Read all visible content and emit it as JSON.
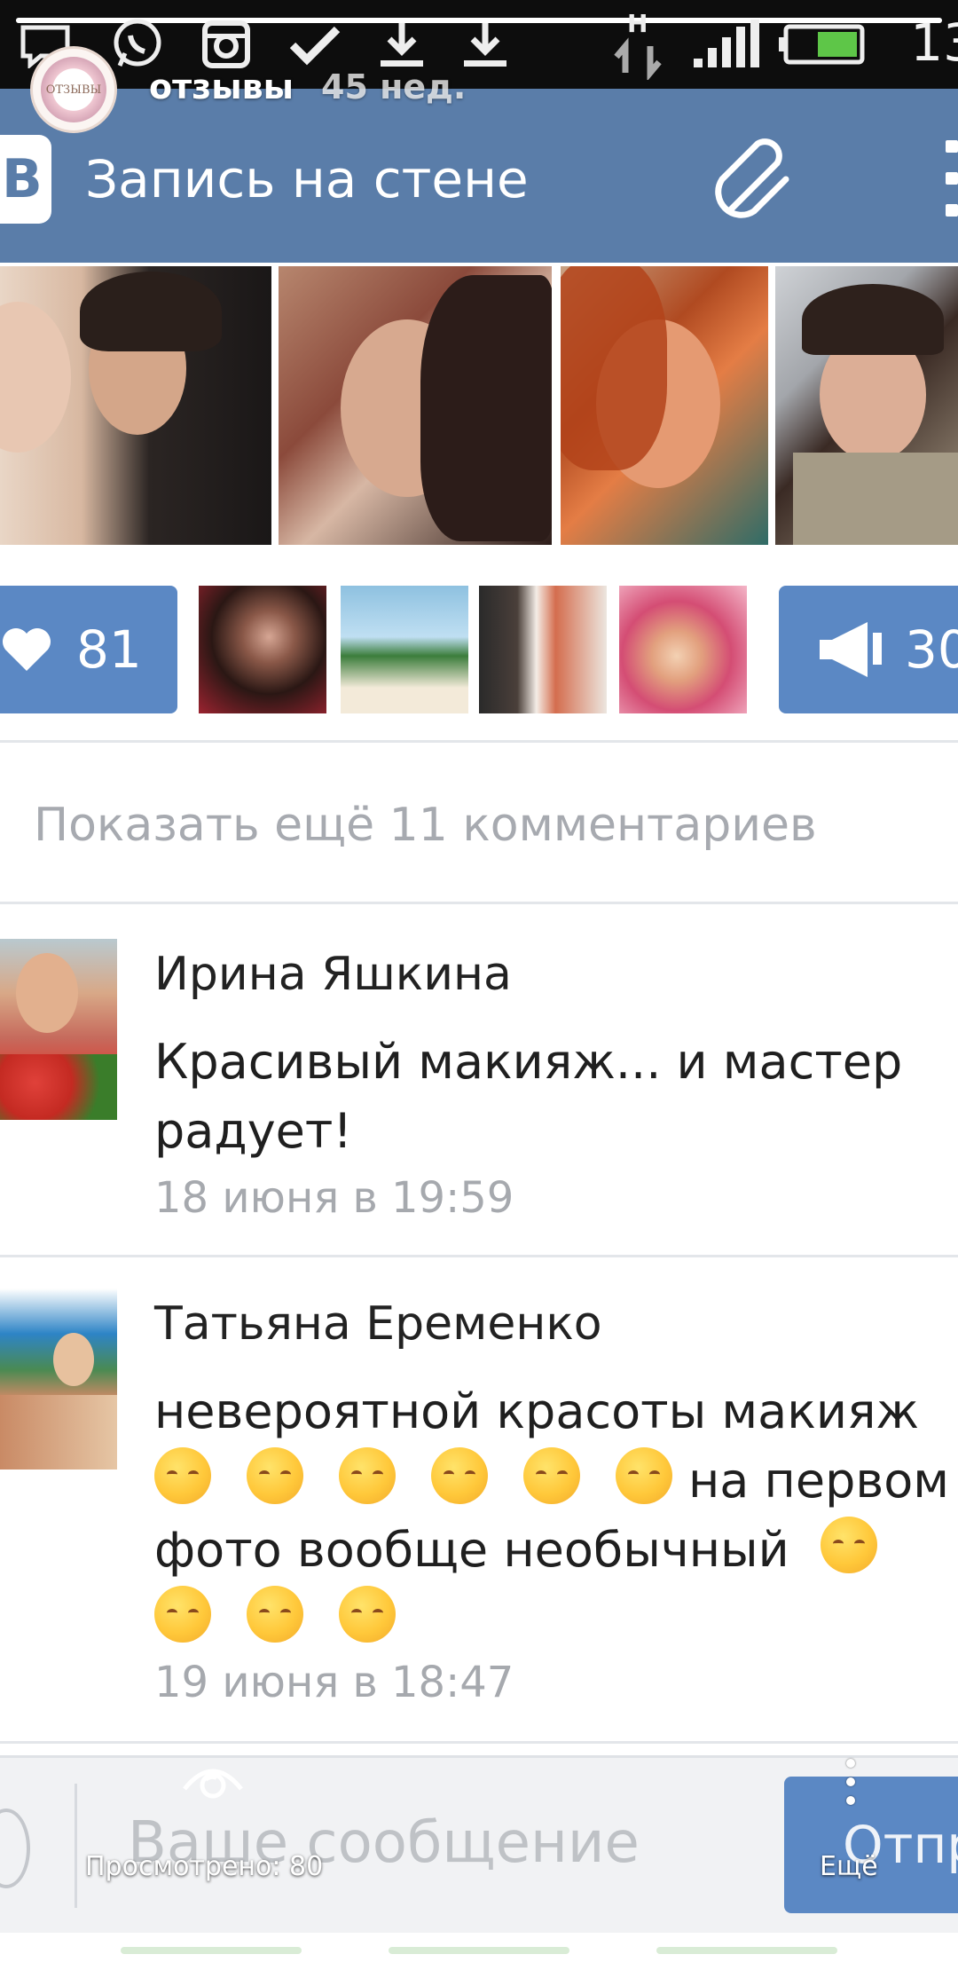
{
  "status_bar": {
    "time": "13",
    "icons": [
      "message-icon",
      "whatsapp-icon",
      "instagram-icon",
      "check-icon",
      "download-icon",
      "download-icon",
      "data-transfer-icon",
      "signal-icon",
      "battery-icon"
    ],
    "network_label": "H"
  },
  "story": {
    "username": "отзывы",
    "age": "45 нед.",
    "avatar_text": "ОТЗЫВЫ",
    "views_label": "Просмотрено: 80",
    "more_label": "Ещё"
  },
  "vk": {
    "logo": "В",
    "title": "Запись на стене"
  },
  "actions": {
    "likes": "81",
    "shares": "30"
  },
  "comments_section": {
    "show_more": "Показать ещё 11 комментариев",
    "comments": [
      {
        "author": "Ирина Яшкина",
        "lines": [
          "Красивый макияж... и мастер",
          "радует!"
        ],
        "date": "18 июня в 19:59"
      },
      {
        "author": "Татьяна Еременко",
        "line1": "невероятной красоты макияж",
        "line2_text": "на первом",
        "line3_text": "фото вообще необычный",
        "date": "19 июня в 18:47"
      }
    ]
  },
  "input": {
    "placeholder": "Ваше сообщение",
    "send_label": "Отпр"
  },
  "colors": {
    "vk_header": "#5a7da9",
    "vk_button": "#5b88c4",
    "muted_text": "#a6a9ae"
  }
}
